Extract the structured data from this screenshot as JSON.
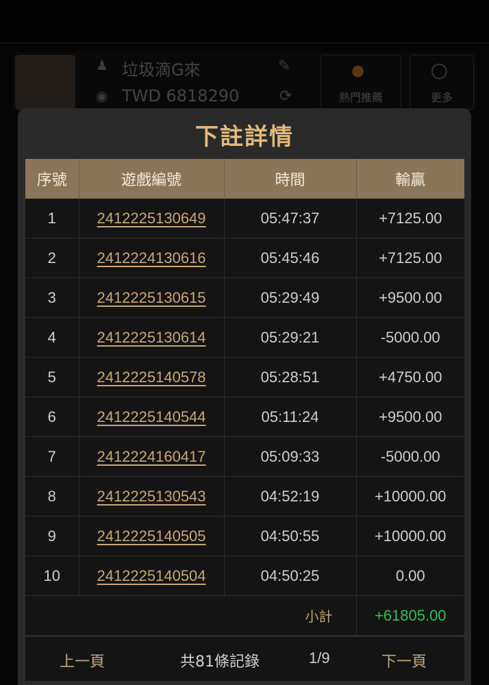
{
  "background": {
    "username": "垃圾滴G來",
    "balance": "TWD 6818290",
    "button1_label": "熱門推薦",
    "button2_label": "更多"
  },
  "modal": {
    "title": "下註詳情",
    "columns": [
      "序號",
      "遊戲編號",
      "時間",
      "輸贏"
    ],
    "rows": [
      {
        "seq": "1",
        "game_id": "2412225130649",
        "time": "05:47:37",
        "win_loss": "+7125.00",
        "sign": "pos"
      },
      {
        "seq": "2",
        "game_id": "2412224130616",
        "time": "05:45:46",
        "win_loss": "+7125.00",
        "sign": "pos"
      },
      {
        "seq": "3",
        "game_id": "2412225130615",
        "time": "05:29:49",
        "win_loss": "+9500.00",
        "sign": "pos"
      },
      {
        "seq": "4",
        "game_id": "2412225130614",
        "time": "05:29:21",
        "win_loss": "-5000.00",
        "sign": "neg"
      },
      {
        "seq": "5",
        "game_id": "2412225140578",
        "time": "05:28:51",
        "win_loss": "+4750.00",
        "sign": "pos"
      },
      {
        "seq": "6",
        "game_id": "2412225140544",
        "time": "05:11:24",
        "win_loss": "+9500.00",
        "sign": "pos"
      },
      {
        "seq": "7",
        "game_id": "2412224160417",
        "time": "05:09:33",
        "win_loss": "-5000.00",
        "sign": "neg"
      },
      {
        "seq": "8",
        "game_id": "2412225130543",
        "time": "04:52:19",
        "win_loss": "+10000.00",
        "sign": "pos"
      },
      {
        "seq": "9",
        "game_id": "2412225140505",
        "time": "04:50:55",
        "win_loss": "+10000.00",
        "sign": "pos"
      },
      {
        "seq": "10",
        "game_id": "2412225140504",
        "time": "04:50:25",
        "win_loss": "0.00",
        "sign": "zero"
      }
    ],
    "subtotal_label": "小計",
    "subtotal_value": "+61805.00",
    "pagination": {
      "prev_label": "上一頁",
      "total_text": "共81條記錄",
      "page_indicator": "1/9",
      "next_label": "下一頁"
    }
  },
  "colors": {
    "accent_gold": "#e2b97b",
    "header_bg": "#8a7558",
    "positive": "#34c24a",
    "negative": "#d93434"
  }
}
